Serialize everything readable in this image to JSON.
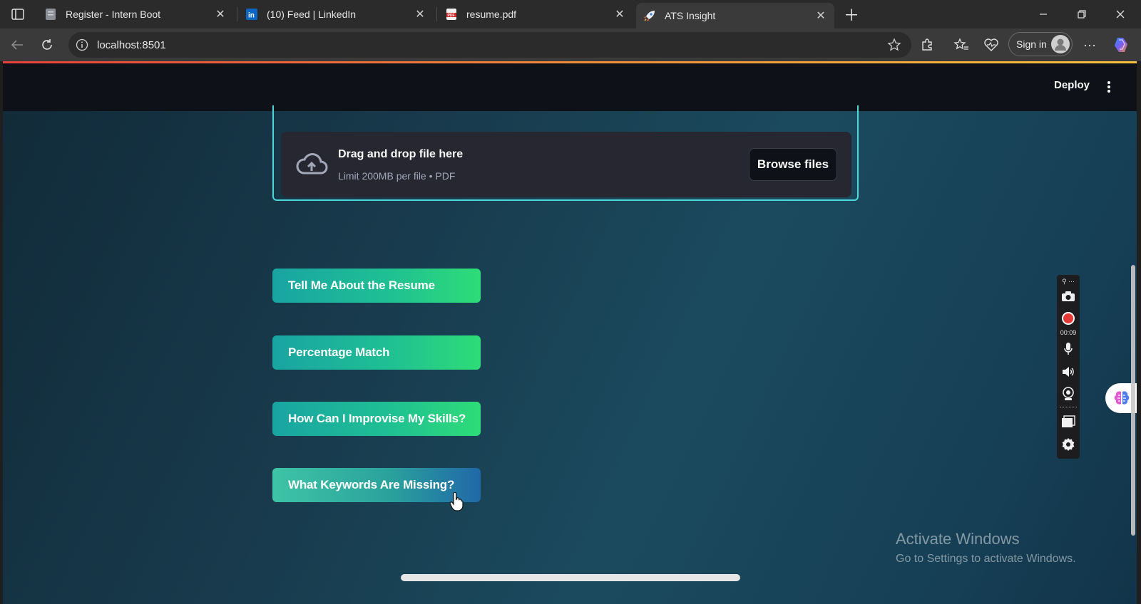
{
  "browser": {
    "tabs": [
      {
        "title": "Register - Intern Boot",
        "icon": "document-icon"
      },
      {
        "title": "(10) Feed | LinkedIn",
        "icon": "linkedin-icon"
      },
      {
        "title": "resume.pdf",
        "icon": "pdf-icon"
      },
      {
        "title": "ATS Insight",
        "icon": "rocket-icon",
        "active": true
      }
    ],
    "url": "localhost:8501",
    "signin_label": "Sign in"
  },
  "app": {
    "deploy_label": "Deploy",
    "uploader": {
      "title": "Drag and drop file here",
      "subtitle": "Limit 200MB per file • PDF",
      "browse_label": "Browse files"
    },
    "actions": [
      {
        "label": "Tell Me About the Resume"
      },
      {
        "label": "Percentage Match"
      },
      {
        "label": "How Can I Improvise My Skills?"
      },
      {
        "label": "What Keywords Are Missing?"
      }
    ]
  },
  "recorder": {
    "time": "00:09",
    "record_color": "#e53935"
  },
  "watermark": {
    "line1": "Activate Windows",
    "line2": "Go to Settings to activate Windows."
  }
}
